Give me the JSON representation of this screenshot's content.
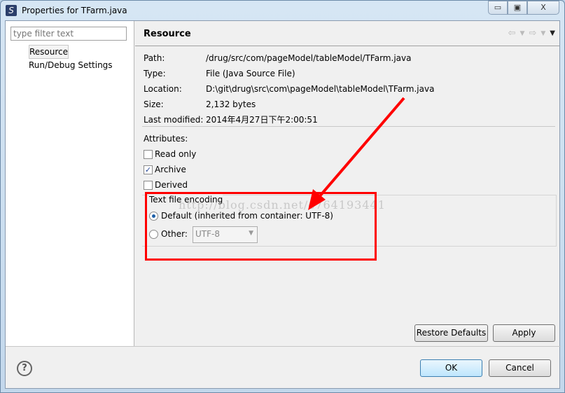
{
  "window": {
    "title": "Properties for TFarm.java",
    "minimize": "▭",
    "maximize": "▣",
    "close": "X"
  },
  "sidebar": {
    "filter_placeholder": "type filter text",
    "items": [
      {
        "label": "Resource",
        "selected": true
      },
      {
        "label": "Run/Debug Settings"
      }
    ]
  },
  "page": {
    "title": "Resource",
    "nav_icons": [
      "back-arrow-icon",
      "dropdown-icon",
      "forward-arrow-icon",
      "dropdown-icon",
      "view-menu-icon"
    ]
  },
  "properties": [
    {
      "key": "Path:",
      "value": "/drug/src/com/pageModel/tableModel/TFarm.java"
    },
    {
      "key": "Type:",
      "value": "File  (Java Source File)"
    },
    {
      "key": "Location:",
      "value": "D:\\git\\drug\\src\\com\\pageModel\\tableModel\\TFarm.java"
    },
    {
      "key": "Size:",
      "value": "2,132  bytes"
    },
    {
      "key": "Last modified:",
      "value": "2014年4月27日下午2:00:51"
    }
  ],
  "attributes": {
    "label": "Attributes:",
    "items": [
      {
        "label": "Read only",
        "checked": false
      },
      {
        "label": "Archive",
        "checked": true
      },
      {
        "label": "Derived",
        "checked": false
      }
    ]
  },
  "encoding": {
    "label": "Text file encoding",
    "default_label": "Default (inherited from container: UTF-8)",
    "default_selected": true,
    "other_label": "Other:",
    "other_value": "UTF-8"
  },
  "watermark": "http://blog.csdn.net/c764193441",
  "buttons": {
    "restore_defaults": "Restore Defaults",
    "apply": "Apply",
    "ok": "OK",
    "cancel": "Cancel",
    "help": "?"
  },
  "annotation_color": "#ff0000"
}
